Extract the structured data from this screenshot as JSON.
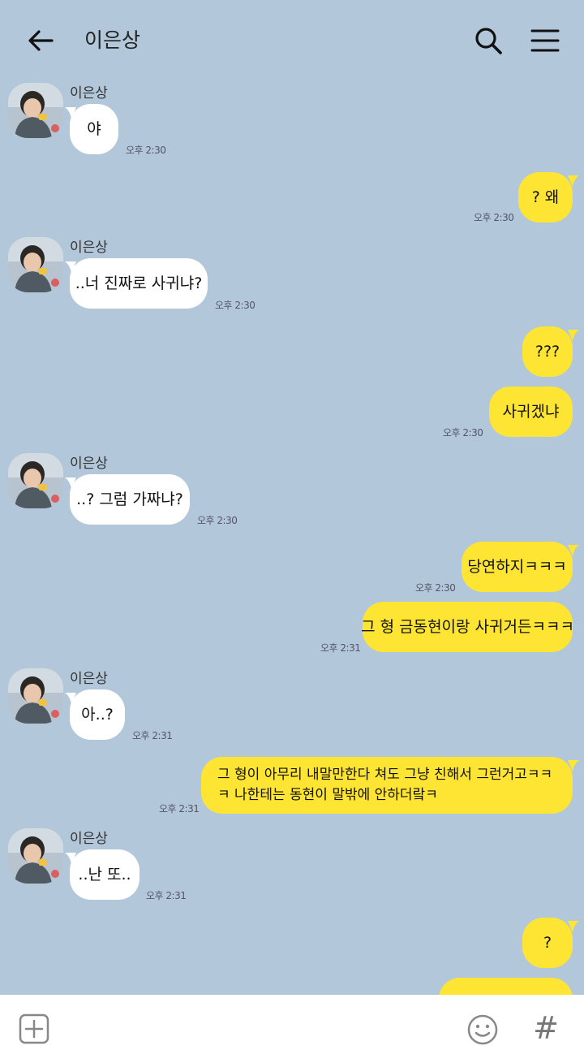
{
  "header": {
    "title": "이은상"
  },
  "sender_name": "이은상",
  "messages": [
    {
      "side": "in",
      "text": "야",
      "time": "오후 2:30"
    },
    {
      "side": "out",
      "text": "? 왜",
      "time": "오후 2:30"
    },
    {
      "side": "in",
      "text": "..너 진짜로 사귀냐?",
      "time": "오후 2:30"
    },
    {
      "side": "out",
      "text": "???",
      "time": ""
    },
    {
      "side": "out",
      "text": "사귀겠냐",
      "time": "오후 2:30"
    },
    {
      "side": "in",
      "text": "..? 그럼 가짜냐?",
      "time": "오후 2:30"
    },
    {
      "side": "out",
      "text": "당연하지ㅋㅋㅋ",
      "time": "오후 2:30"
    },
    {
      "side": "out",
      "text": "그 형 금동현이랑 사귀거든ㅋㅋㅋ",
      "time": "오후 2:31"
    },
    {
      "side": "in",
      "text": "아..?",
      "time": "오후 2:31"
    },
    {
      "side": "out",
      "text": "그 형이 아무리 내말만한다 쳐도 그냥 친해서 그런거고ㅋㅋㅋ 나한테는 동현이 말밖에 안하더랔ㅋ",
      "time": "오후 2:31"
    },
    {
      "side": "in",
      "text": "..난 또..",
      "time": "오후 2:31"
    },
    {
      "side": "out",
      "text": "?",
      "time": ""
    }
  ],
  "colors": {
    "background": "#b2c7da",
    "my_bubble": "#fee533",
    "their_bubble": "#ffffff"
  },
  "icons": {
    "back": "arrow-left-icon",
    "search": "search-icon",
    "menu": "hamburger-menu-icon",
    "attach": "plus-square-icon",
    "emoji": "smiley-icon",
    "hashtag": "hashtag-icon"
  },
  "composer": {
    "hashtag_glyph": "#"
  }
}
